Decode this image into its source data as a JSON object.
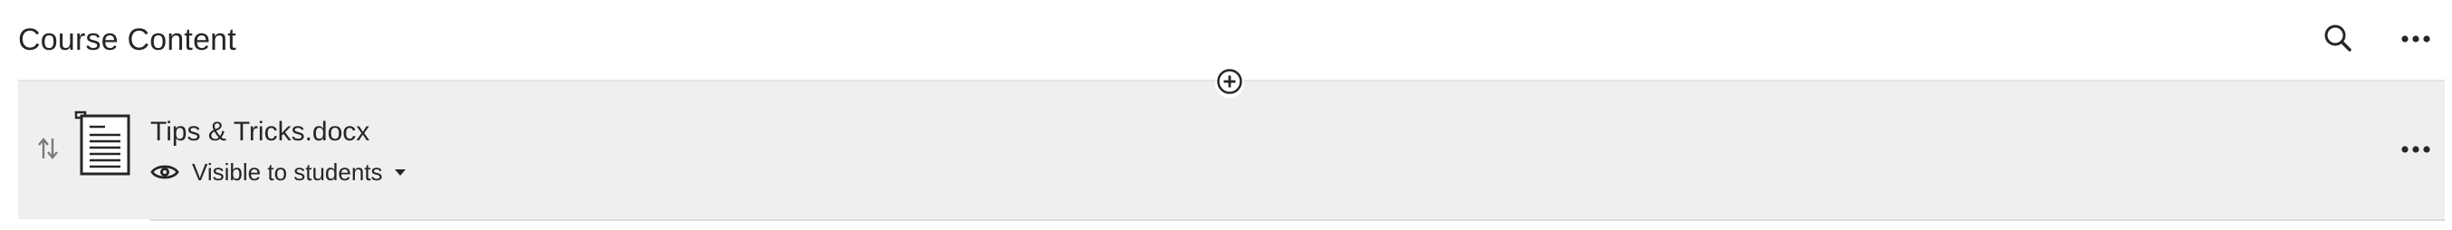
{
  "header": {
    "title": "Course Content",
    "search_icon": "search-icon",
    "more_icon": "more-horizontal-icon"
  },
  "add_content": {
    "icon": "plus-circle-icon"
  },
  "content_items": [
    {
      "title": "Tips & Tricks.docx",
      "icon": "document-icon",
      "reorder_icon": "reorder-arrows-icon",
      "visibility": {
        "label": "Visible to students",
        "icon": "eye-icon",
        "dropdown_icon": "caret-down-icon"
      },
      "more_icon": "more-horizontal-icon"
    }
  ],
  "colors": {
    "text": "#262626",
    "row_background": "#efefef",
    "divider": "#e4e4e4"
  }
}
